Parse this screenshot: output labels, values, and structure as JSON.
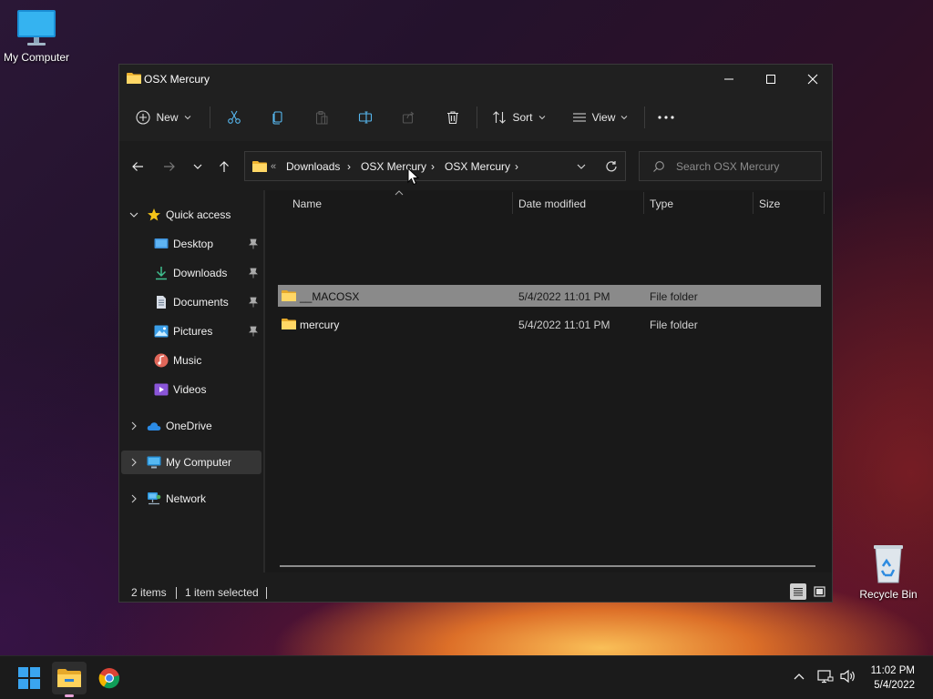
{
  "desktop": {
    "my_computer_label": "My Computer",
    "recycle_bin_label": "Recycle Bin"
  },
  "window": {
    "title": "OSX Mercury"
  },
  "toolbar": {
    "new_label": "New",
    "sort_label": "Sort",
    "view_label": "View"
  },
  "address": {
    "overflow": "«",
    "crumbs": [
      "Downloads",
      "OSX Mercury",
      "OSX Mercury"
    ]
  },
  "search": {
    "placeholder": "Search OSX Mercury"
  },
  "sidebar": {
    "quick_access": "Quick access",
    "items": [
      {
        "label": "Desktop",
        "pinned": true
      },
      {
        "label": "Downloads",
        "pinned": true
      },
      {
        "label": "Documents",
        "pinned": true
      },
      {
        "label": "Pictures",
        "pinned": true
      },
      {
        "label": "Music",
        "pinned": false
      },
      {
        "label": "Videos",
        "pinned": false
      }
    ],
    "onedrive": "OneDrive",
    "my_computer": "My Computer",
    "network": "Network"
  },
  "columns": {
    "name": "Name",
    "date": "Date modified",
    "type": "Type",
    "size": "Size"
  },
  "files": [
    {
      "name": "__MACOSX",
      "date": "5/4/2022 11:01 PM",
      "type": "File folder",
      "size": "",
      "selected": true
    },
    {
      "name": "mercury",
      "date": "5/4/2022 11:01 PM",
      "type": "File folder",
      "size": "",
      "selected": false
    }
  ],
  "status": {
    "count": "2 items",
    "selected": "1 item selected"
  },
  "taskbar": {
    "time": "11:02 PM",
    "date": "5/4/2022"
  },
  "colors": {
    "accent": "#4cc2ff",
    "folder": "#f5c342",
    "selected_row": "#8a8a8a"
  }
}
